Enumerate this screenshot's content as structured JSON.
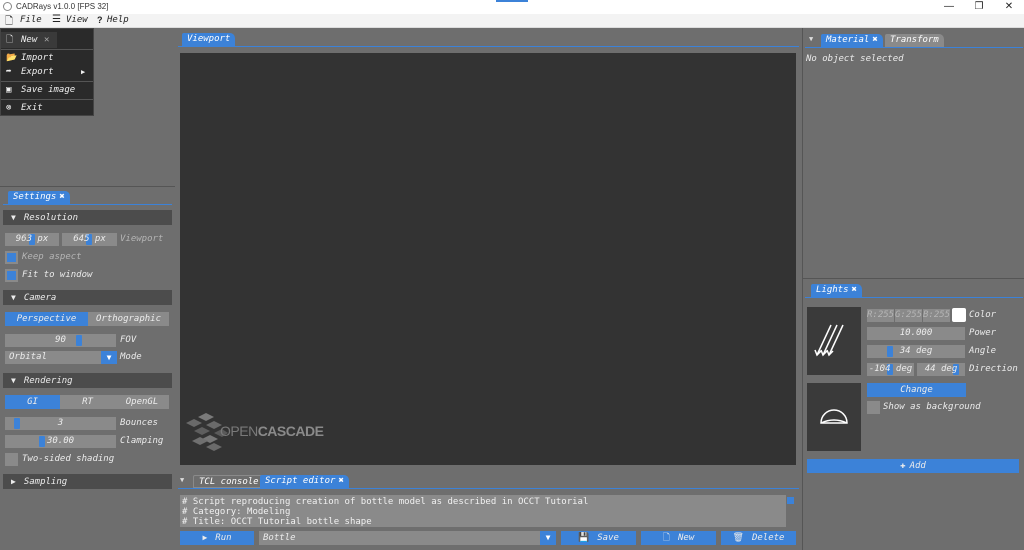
{
  "window": {
    "title": "CADRays v1.0.0 [FPS 32]",
    "buttons": [
      "—",
      "❐",
      "✕"
    ]
  },
  "menubar": {
    "file": "File",
    "view": "View",
    "help": "Help"
  },
  "file_menu": {
    "items": [
      "New",
      "Import",
      "Export",
      "Save image",
      "Exit"
    ],
    "close_glyph": "✕",
    "submenu_arrow": "▶"
  },
  "viewport": {
    "tab": "Viewport",
    "logo_part1": "OPEN",
    "logo_part2": "CASCADE"
  },
  "settings": {
    "tab": "Settings",
    "resolution": {
      "header": "Resolution",
      "width": "963 px",
      "height": "645 px",
      "label": "Viewport",
      "keep_aspect": "Keep aspect",
      "keep_aspect_checked": true,
      "fit_to_window": "Fit to window",
      "fit_to_window_checked": true
    },
    "camera": {
      "header": "Camera",
      "perspective": "Perspective",
      "orthographic": "Orthographic",
      "selected": "Perspective",
      "fov_value": "90",
      "fov_label": "FOV",
      "mode_value": "Orbital",
      "mode_label": "Mode"
    },
    "rendering": {
      "header": "Rendering",
      "gi": "GI",
      "rt": "RT",
      "opengl": "OpenGL",
      "selected": "GI",
      "bounces_value": "3",
      "bounces_label": "Bounces",
      "clamping_value": "30.00",
      "clamping_label": "Clamping",
      "two_sided": "Two-sided shading",
      "two_sided_checked": false
    },
    "sampling": {
      "header": "Sampling"
    }
  },
  "material": {
    "tabs": [
      "Material",
      "Transform"
    ],
    "active_tab": "Material",
    "empty_text": "No object selected"
  },
  "lights": {
    "tab": "Lights",
    "color_r": "R:255",
    "color_g": "G:255",
    "color_b": "B:255",
    "color_swatch": "#ffffff",
    "color_label": "Color",
    "power_value": "10.000",
    "power_label": "Power",
    "angle_value": "34 deg",
    "angle_label": "Angle",
    "dir_1": "-104 deg",
    "dir_2": "44 deg",
    "direction_label": "Direction",
    "change_button": "Change",
    "show_bg": "Show as background",
    "show_bg_checked": false,
    "add_button": "Add"
  },
  "console": {
    "tabs": [
      "TCL console",
      "Script editor"
    ],
    "active_tab": "Script editor",
    "lines": [
      "# Script reproducing creation of bottle model as described in OCCT Tutorial",
      "# Category: Modeling",
      "# Title: OCCT Tutorial bottle shape"
    ],
    "run_button": "Run",
    "script_name": "Bottle",
    "save_button": "Save",
    "new_button": "New",
    "delete_button": "Delete"
  },
  "colors": {
    "accent": "#3c82d8",
    "panel": "#6e6e6e",
    "viewport": "#333333",
    "field": "#8a8a8a"
  }
}
